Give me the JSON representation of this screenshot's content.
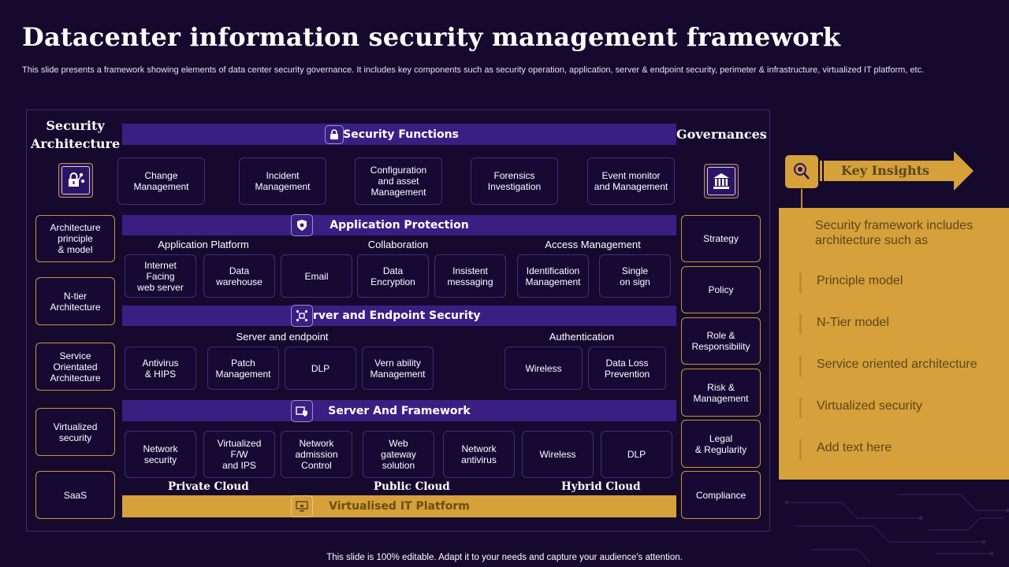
{
  "page": {
    "title": "Datacenter information security management framework",
    "subtitle": "This slide presents a framework showing elements of data center security governance. It includes key components such as security operation, application, server & endpoint security, perimeter & infrastructure, virtualized IT platform, etc.",
    "footer": "This slide is 100% editable. Adapt it to your needs and capture your audience's attention."
  },
  "architecture": {
    "heading": "Security\nArchitecture",
    "icon": "lock-network-icon",
    "items": [
      "Architecture\nprinciple\n& model",
      "N-tier\nArchitecture",
      "Service\nOrientated\nArchitecture",
      "Virtualized\nsecurity",
      "SaaS"
    ]
  },
  "governance": {
    "heading": "Governances",
    "icon": "bank-building-icon",
    "items": [
      "Strategy",
      "Policy",
      "Role &\nResponsibility",
      "Risk &\nManagement",
      "Legal\n& Regularity",
      "Compliance"
    ]
  },
  "security_functions": {
    "label": "Security Functions",
    "icon": "padlock-icon",
    "items": [
      "Change\nManagement",
      "Incident\nManagement",
      "Configuration\nand asset\nManagement",
      "Forensics\nInvestigation",
      "Event monitor\nand Management"
    ]
  },
  "application_protection": {
    "label": "Application Protection",
    "icon": "shield-gear-icon",
    "groups": [
      "Application Platform",
      "Collaboration",
      "Access Management"
    ],
    "items": [
      "Internet\nFacing\nweb server",
      "Data\nwarehouse",
      "Email",
      "Data\nEncryption",
      "Insistent\nmessaging",
      "Identification\nManagement",
      "Single\non sign"
    ]
  },
  "server_endpoint": {
    "label": "Server and Endpoint Security",
    "icon": "network-nodes-icon",
    "groups": [
      "Server  and endpoint",
      "Authentication"
    ],
    "items": [
      "Antivirus\n& HIPS",
      "Patch\nManagement",
      "DLP",
      "Vern ability\nManagement",
      "Wireless",
      "Data Loss\nPrevention"
    ]
  },
  "server_framework": {
    "label": "Server And Framework",
    "icon": "server-shield-icon",
    "items": [
      "Network\nsecurity",
      "Virtualized\nF/W\nand IPS",
      "Network\nadmission\nControl",
      "Web\ngateway\nsolution",
      "Network\nantivirus",
      "Wireless",
      "DLP"
    ]
  },
  "clouds": [
    "Private Cloud",
    "Public Cloud",
    "Hybrid Cloud"
  ],
  "platform": {
    "label": "Virtualised IT Platform",
    "icon": "monitor-lock-icon"
  },
  "insights": {
    "tag": "Key Insights",
    "icon": "magnifier-bug-icon",
    "heading": "Security framework includes architecture  such as",
    "items": [
      "Principle model",
      "N-Tier model",
      "Service oriented architecture",
      "Virtualized security",
      "Add text here"
    ]
  },
  "colors": {
    "background": "#15092e",
    "purple_bar": "#3a1f83",
    "gold": "#d6a03a",
    "box_border": "#3c2f78",
    "gold_border": "#c9962e"
  }
}
